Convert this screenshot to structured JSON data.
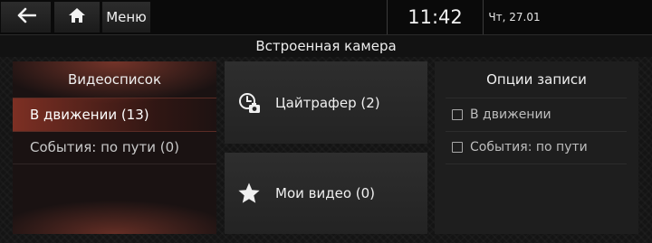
{
  "topbar": {
    "back_icon": "back-arrow-icon",
    "home_icon": "home-icon",
    "menu_label": "Меню",
    "time": "11:42",
    "date": "Чт, 27.01"
  },
  "screen_title": "Встроенная камера",
  "video_list": {
    "title": "Видеосписок",
    "items": [
      {
        "label": "В движении (13)",
        "selected": true
      },
      {
        "label": "События: по пути (0)",
        "selected": false
      }
    ]
  },
  "tiles": [
    {
      "label": "Цайтрафер (2)",
      "icon": "timelapse-camera-icon"
    },
    {
      "label": "Мои видео (0)",
      "icon": "star-icon"
    }
  ],
  "record_options": {
    "title": "Опции записи",
    "items": [
      {
        "label": "В движении",
        "checked": false
      },
      {
        "label": "События: по пути",
        "checked": false
      }
    ]
  },
  "colors": {
    "accent_selected": "#963728",
    "background": "#000000"
  }
}
